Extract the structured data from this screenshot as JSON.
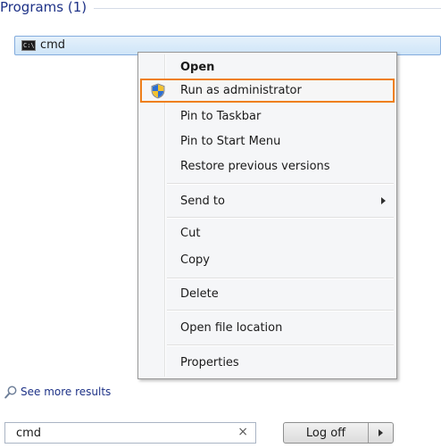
{
  "programs_header": {
    "title": "Programs (1)"
  },
  "program_item": {
    "icon_text": "C:\\",
    "label": "cmd"
  },
  "context_menu": {
    "items": [
      {
        "label": "Open",
        "bold": true
      },
      {
        "label": "Run as administrator",
        "icon": "shield-icon",
        "highlighted": true
      },
      {
        "label": "Pin to Taskbar"
      },
      {
        "label": "Pin to Start Menu"
      },
      {
        "label": "Restore previous versions"
      },
      {
        "label": "Send to",
        "submenu": true
      },
      {
        "label": "Cut"
      },
      {
        "label": "Copy"
      },
      {
        "label": "Delete"
      },
      {
        "label": "Open file location"
      },
      {
        "label": "Properties"
      }
    ],
    "highlight_color": "#ef7f1a"
  },
  "see_more": {
    "label": "See more results",
    "icon": "search-icon"
  },
  "search": {
    "value": "cmd",
    "clear_glyph": "×"
  },
  "logoff": {
    "label": "Log off"
  }
}
